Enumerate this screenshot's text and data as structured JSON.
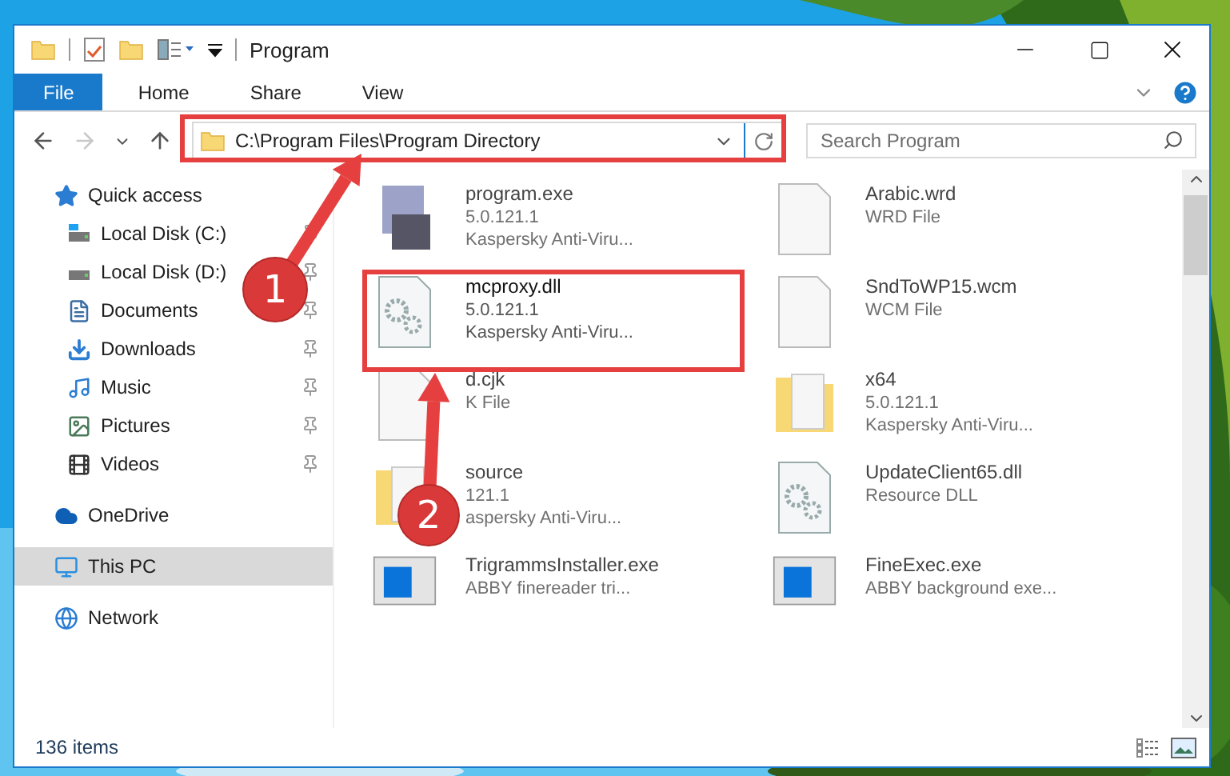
{
  "window": {
    "title": "Program"
  },
  "ribbon_tabs": [
    {
      "label": "File",
      "kind": "menu",
      "selected": false
    },
    {
      "label": "Home",
      "kind": "tab",
      "selected": false
    },
    {
      "label": "Share",
      "kind": "tab",
      "selected": false
    },
    {
      "label": "View",
      "kind": "tab",
      "selected": false
    }
  ],
  "navigation": {
    "back_disabled": false,
    "forward_disabled": true
  },
  "address": {
    "value": "C:\\Program Files\\Program Directory"
  },
  "search": {
    "placeholder": "Search Program"
  },
  "sidebar": {
    "items": [
      {
        "label": "Quick access",
        "kind": "star",
        "selected": false,
        "children": [
          {
            "label": "Local Disk (C:)",
            "kind": "system-drive",
            "pinned": true,
            "selected": false
          },
          {
            "label": "Local Disk (D:)",
            "kind": "drive",
            "pinned": true,
            "selected": false
          },
          {
            "label": "Documents",
            "kind": "documents",
            "pinned": true,
            "selected": false
          },
          {
            "label": "Downloads",
            "kind": "downloads",
            "pinned": true,
            "selected": false
          },
          {
            "label": "Music",
            "kind": "music",
            "pinned": true,
            "selected": false
          },
          {
            "label": "Pictures",
            "kind": "pictures",
            "pinned": true,
            "selected": false
          },
          {
            "label": "Videos",
            "kind": "videos",
            "pinned": true,
            "selected": false
          }
        ]
      },
      {
        "label": "OneDrive",
        "kind": "cloud",
        "selected": false
      },
      {
        "label": "This PC",
        "kind": "computer",
        "selected": true
      },
      {
        "label": "Network",
        "kind": "network",
        "selected": false
      }
    ]
  },
  "files": [
    {
      "name": "program.exe",
      "details": [
        "5.0.121.1",
        "Kaspersky Anti-Viru..."
      ],
      "kind": "exe",
      "faded": true
    },
    {
      "name": "Arabic.wrd",
      "details": [
        "WRD File"
      ],
      "kind": "file",
      "faded": true
    },
    {
      "name": "mcproxy.dll",
      "details": [
        "5.0.121.1",
        "Kaspersky Anti-Viru..."
      ],
      "kind": "dll",
      "faded": false
    },
    {
      "name": "SndToWP15.wcm",
      "details": [
        "WCM File"
      ],
      "kind": "file",
      "faded": true
    },
    {
      "name": "d.cjk",
      "details": [
        "K File"
      ],
      "kind": "file",
      "faded": true
    },
    {
      "name": "x64",
      "details": [
        "5.0.121.1",
        "Kaspersky Anti-Viru..."
      ],
      "kind": "folder",
      "faded": true
    },
    {
      "name": "source",
      "details": [
        "121.1",
        "aspersky Anti-Viru..."
      ],
      "kind": "folder",
      "faded": true
    },
    {
      "name": "UpdateClient65.dll",
      "details": [
        "Resource DLL"
      ],
      "kind": "dll",
      "faded": true
    },
    {
      "name": "TrigrammsInstaller.exe",
      "details": [
        "ABBY finereader tri..."
      ],
      "kind": "app",
      "faded": true
    },
    {
      "name": "FineExec.exe",
      "details": [
        "ABBY background exe..."
      ],
      "kind": "app",
      "faded": true
    }
  ],
  "status_bar": {
    "item_count": "136 items"
  },
  "annotations": [
    {
      "kind": "box"
    },
    {
      "kind": "box"
    },
    {
      "kind": "arrow",
      "label": "1"
    },
    {
      "kind": "arrow",
      "label": "2"
    }
  ]
}
